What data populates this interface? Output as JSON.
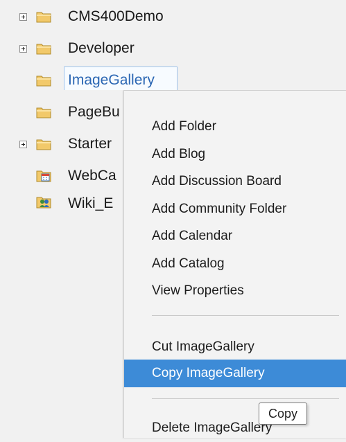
{
  "tree": {
    "items": [
      {
        "label": "CMS400Demo",
        "expandable": true,
        "icon": "folder-icon"
      },
      {
        "label": "Developer",
        "expandable": true,
        "icon": "folder-icon"
      },
      {
        "label": "ImageGallery",
        "expandable": false,
        "icon": "folder-icon",
        "selected": true
      },
      {
        "label": "PageBu",
        "expandable": false,
        "icon": "folder-icon"
      },
      {
        "label": "Starter",
        "expandable": true,
        "icon": "folder-icon"
      },
      {
        "label": "WebCa",
        "expandable": false,
        "icon": "calendar-folder-icon"
      },
      {
        "label": "Wiki_E",
        "expandable": false,
        "icon": "community-folder-icon"
      }
    ]
  },
  "context_menu": {
    "items": [
      "Add Folder",
      "Add Blog",
      "Add Discussion Board",
      "Add Community Folder",
      "Add Calendar",
      "Add Catalog",
      "View Properties",
      "Cut ImageGallery",
      "Copy ImageGallery",
      "Delete ImageGallery"
    ],
    "highlighted": "Copy ImageGallery"
  },
  "tooltip": {
    "text": "Copy"
  },
  "colors": {
    "highlight": "#3d8bd7",
    "selected_text": "#2a66b3",
    "folder": "#f2c96a"
  }
}
